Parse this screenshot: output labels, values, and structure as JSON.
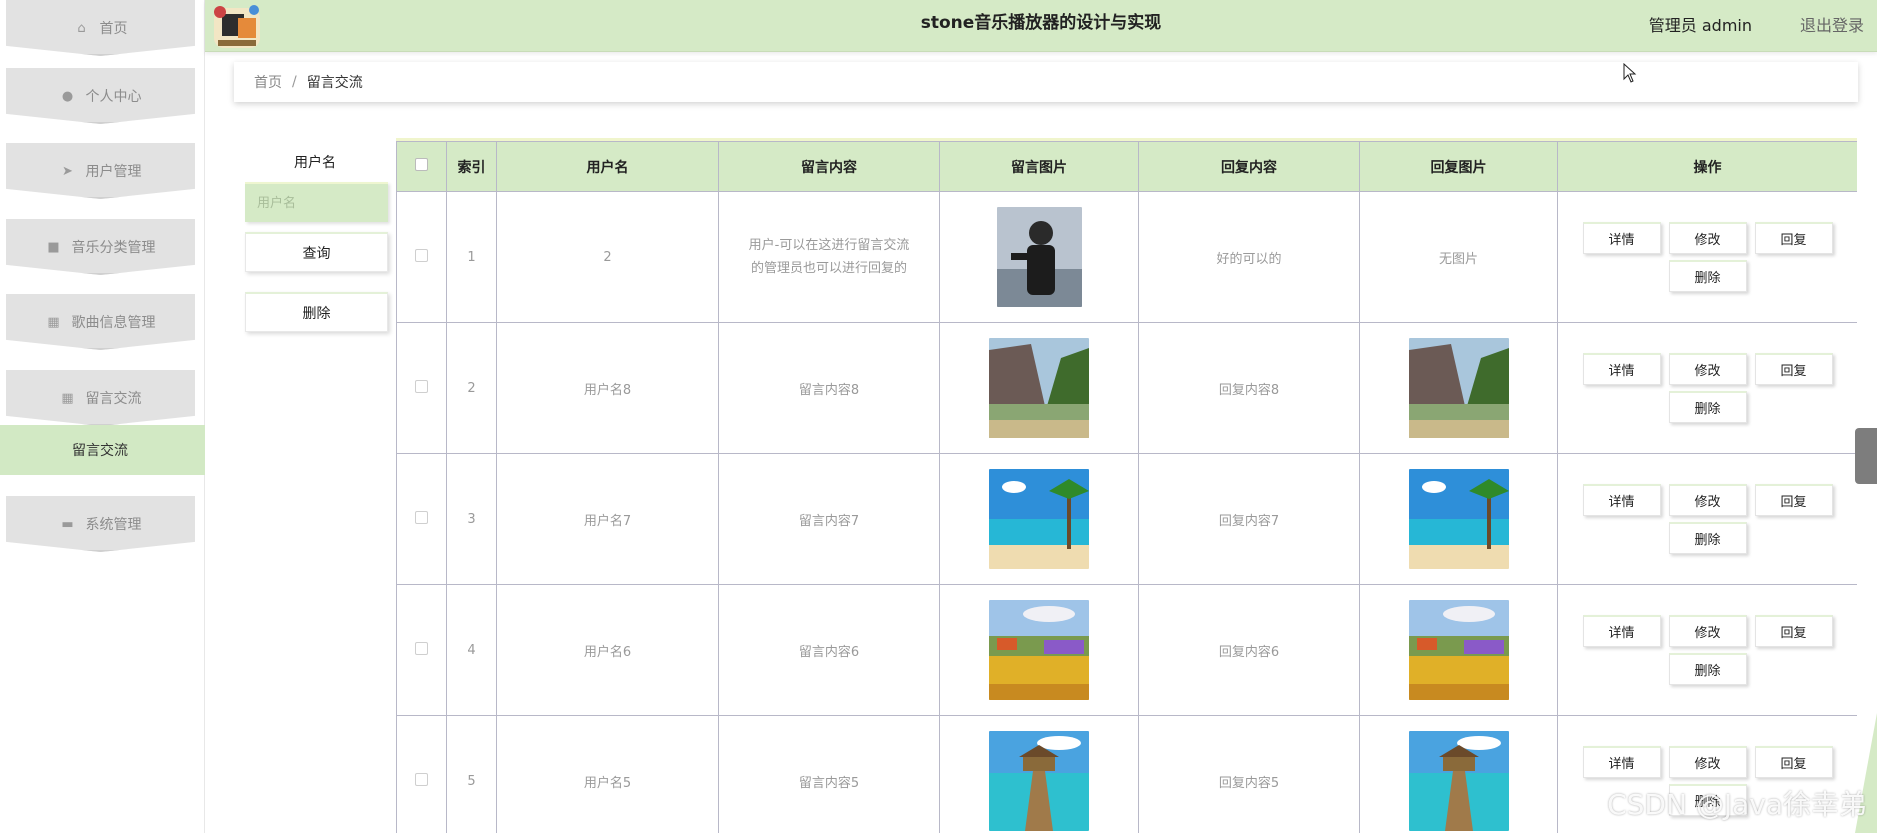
{
  "sidebar": {
    "items": [
      {
        "label": "首页",
        "icon": "home-icon"
      },
      {
        "label": "个人中心",
        "icon": "user-icon"
      },
      {
        "label": "用户管理",
        "icon": "send-icon"
      },
      {
        "label": "音乐分类管理",
        "icon": "briefcase-icon"
      },
      {
        "label": "歌曲信息管理",
        "icon": "grid-icon"
      },
      {
        "label": "留言交流",
        "icon": "grid-icon"
      },
      {
        "label": "系统管理",
        "icon": "monitor-icon"
      }
    ],
    "submenu_active": "留言交流"
  },
  "header": {
    "title": "stone音乐播放器的设计与实现",
    "user": "管理员 admin",
    "logout": "退出登录"
  },
  "breadcrumb": {
    "home": "首页",
    "separator": "/",
    "current": "留言交流"
  },
  "search": {
    "label": "用户名",
    "placeholder": "用户名",
    "query_button": "查询",
    "delete_button": "删除"
  },
  "table": {
    "columns": [
      "索引",
      "用户名",
      "留言内容",
      "留言图片",
      "回复内容",
      "回复图片",
      "操作"
    ],
    "rows": [
      {
        "index": "1",
        "username": "2",
        "content": "用户-可以在这进行留言交流的管理员也可以进行回复的",
        "image": "person",
        "reply": "好的可以的",
        "reply_image": "无图片"
      },
      {
        "index": "2",
        "username": "用户名8",
        "content": "留言内容8",
        "image": "cliff",
        "reply": "回复内容8",
        "reply_image": "cliff"
      },
      {
        "index": "3",
        "username": "用户名7",
        "content": "留言内容7",
        "image": "beach",
        "reply": "回复内容7",
        "reply_image": "beach"
      },
      {
        "index": "4",
        "username": "用户名6",
        "content": "留言内容6",
        "image": "flowers",
        "reply": "回复内容6",
        "reply_image": "flowers"
      },
      {
        "index": "5",
        "username": "用户名5",
        "content": "留言内容5",
        "image": "pier",
        "reply": "回复内容5",
        "reply_image": "pier"
      }
    ],
    "actions": [
      "详情",
      "修改",
      "回复",
      "删除"
    ]
  },
  "watermark": "CSDN @Java徐幸弟",
  "colors": {
    "accent": "#d5eac6",
    "border": "#b8b8c8"
  }
}
